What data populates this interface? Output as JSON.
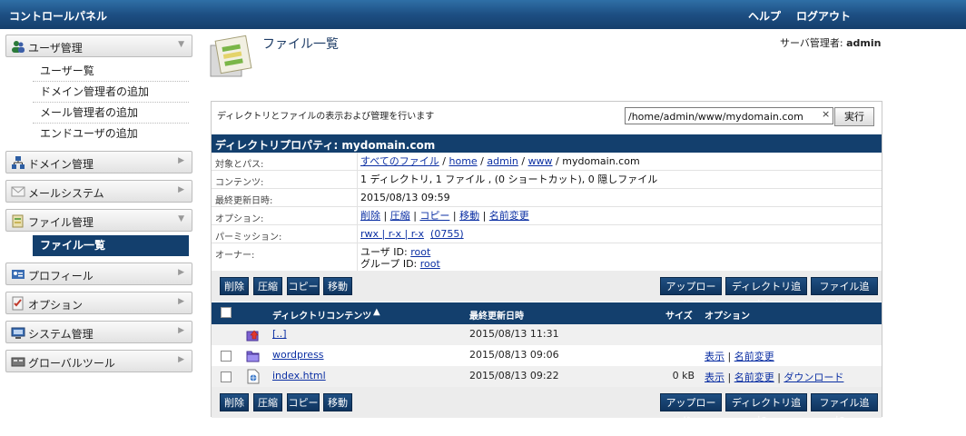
{
  "topbar": {
    "title": "コントロールパネル",
    "help": "ヘルプ",
    "logout": "ログアウト"
  },
  "sidebar": {
    "user_mgmt": {
      "label": "ユーザ管理",
      "items": [
        "ユーザー覧",
        "ドメイン管理者の追加",
        "メール管理者の追加",
        "エンドユーザの追加"
      ]
    },
    "domain_mgmt": "ドメイン管理",
    "mail_system": "メールシステム",
    "file_mgmt": {
      "label": "ファイル管理",
      "items": [
        "ファイル一覧"
      ]
    },
    "profile": "プロフィール",
    "options": "オプション",
    "system_mgmt": "システム管理",
    "global_tools": "グローバルツール"
  },
  "header": {
    "title": "ファイル一覧",
    "admin_prefix": "サーバ管理者:",
    "admin_name": "admin"
  },
  "panel": {
    "description": "ディレクトリとファイルの表示および管理を行います",
    "path_value": "/home/admin/www/mydomain.com",
    "clear_glyph": "×",
    "run_label": "実行",
    "prop_title": "ディレクトリプロパティ: mydomain.com",
    "target_path": {
      "key": "対象とパス:",
      "all_files": "すべてのファイル",
      "sep": " / ",
      "home": "home",
      "admin": "admin",
      "www": "www",
      "current": "mydomain.com"
    },
    "contents": {
      "key": "コンテンツ:",
      "value": "1 ディレクトリ, 1 ファイル , (0 ショートカット), 0 隠しファイル"
    },
    "last_modified": {
      "key": "最終更新日時:",
      "value": "2015/08/13 09:59"
    },
    "options": {
      "key": "オプション:",
      "delete": "削除",
      "compress": "圧縮",
      "copy": "コピー",
      "move": "移動",
      "rename": "名前変更",
      "bar": " | "
    },
    "permission": {
      "key": "パーミッション:",
      "value": "rwx | r-x | r-x",
      "octal": "(0755)"
    },
    "owner": {
      "key": "オーナー:",
      "user_label": "ユーザ ID:",
      "user": "root",
      "group_label": "グループ ID:",
      "group": "root"
    }
  },
  "toolbar": {
    "delete": "削除",
    "compress": "圧縮",
    "copy": "コピー",
    "move": "移動",
    "upload": "アップロード...",
    "add_dir": "ディレクトリ追加...",
    "add_file": "ファイル追加..."
  },
  "list": {
    "col_name": "ディレクトリコンテンツ",
    "sort_glyph": "▲",
    "col_date": "最終更新日時",
    "col_size": "サイズ",
    "col_options": "オプション",
    "rows": [
      {
        "name": "[..]",
        "date": "2015/08/13 11:31",
        "size": "",
        "view": "",
        "rename": "",
        "download": "",
        "icon": "parent-dir-icon"
      },
      {
        "name": "wordpress",
        "date": "2015/08/13 09:06",
        "size": "",
        "view": "表示",
        "rename": "名前変更",
        "download": "",
        "icon": "folder-icon"
      },
      {
        "name": "index.html",
        "date": "2015/08/13 09:22",
        "size": "0 kB",
        "view": "表示",
        "rename": "名前変更",
        "download": "ダウンロード",
        "icon": "file-icon"
      }
    ],
    "bar": " | "
  }
}
